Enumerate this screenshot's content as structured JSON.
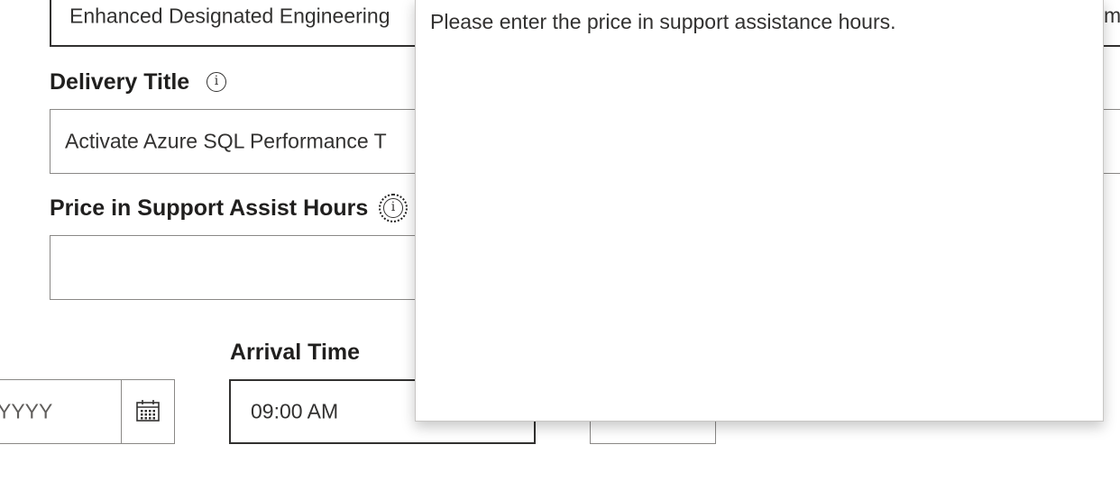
{
  "form": {
    "program_value": "Enhanced Designated Engineering",
    "program_value_tail": "m",
    "delivery_title": {
      "label": "Delivery Title",
      "value": "Activate Azure SQL Performance T"
    },
    "price": {
      "label": "Price in Support Assist Hours",
      "value": ""
    },
    "date": {
      "placeholder": "YYYY"
    },
    "arrival_time": {
      "label": "Arrival Time",
      "value": "09:00 AM"
    },
    "info_glyph": "i"
  },
  "tooltip": {
    "text": "Please enter the price in support assistance hours."
  },
  "icons": {
    "info": "info-circle-icon",
    "calendar": "calendar-icon"
  }
}
